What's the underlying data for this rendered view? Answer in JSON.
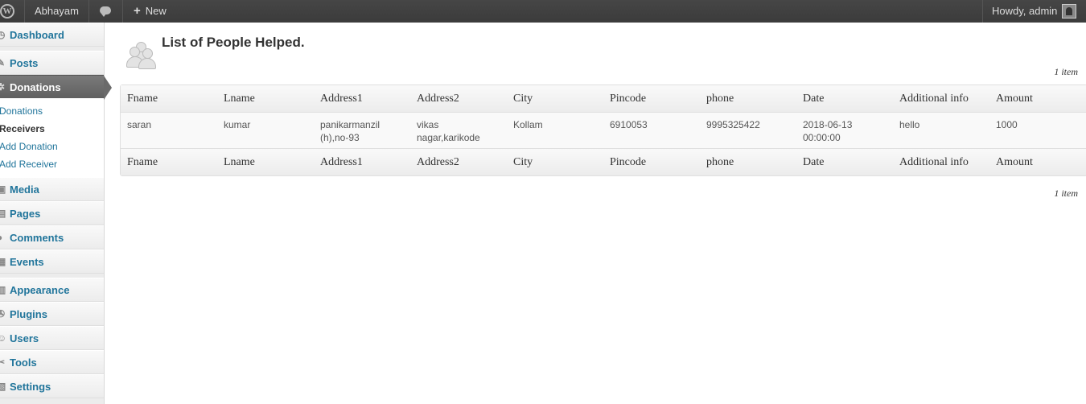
{
  "adminbar": {
    "logo_letter": "W",
    "site_name": "Abhayam",
    "new_label": "New",
    "howdy": "Howdy, admin"
  },
  "sidebar": {
    "items": [
      {
        "label": "Dashboard",
        "icon": "dashboard-icon"
      },
      {
        "label": "Posts",
        "icon": "posts-icon"
      },
      {
        "label": "Donations",
        "icon": "donations-icon"
      },
      {
        "label": "Media",
        "icon": "media-icon"
      },
      {
        "label": "Pages",
        "icon": "pages-icon"
      },
      {
        "label": "Comments",
        "icon": "comments-icon"
      },
      {
        "label": "Events",
        "icon": "events-icon"
      },
      {
        "label": "Appearance",
        "icon": "appearance-icon"
      },
      {
        "label": "Plugins",
        "icon": "plugins-icon"
      },
      {
        "label": "Users",
        "icon": "users-icon"
      },
      {
        "label": "Tools",
        "icon": "tools-icon"
      },
      {
        "label": "Settings",
        "icon": "settings-icon"
      }
    ],
    "submenu": [
      "Donations",
      "Receivers",
      "Add Donation",
      "Add Receiver"
    ]
  },
  "main": {
    "title": "List of People Helped.",
    "item_count": "1 item",
    "columns": [
      "Fname",
      "Lname",
      "Address1",
      "Address2",
      "City",
      "Pincode",
      "phone",
      "Date",
      "Additional info",
      "Amount"
    ],
    "rows": [
      [
        "saran",
        "kumar",
        "panikarmanzil (h),no-93",
        "vikas nagar,karikode",
        "Kollam",
        "6910053",
        "9995325422",
        "2018-06-13 00:00:00",
        "hello",
        "1000"
      ]
    ]
  },
  "colors": {
    "adminbar_bg": "#464646",
    "link": "#21759b",
    "active_menu": "#6a6a6a"
  }
}
